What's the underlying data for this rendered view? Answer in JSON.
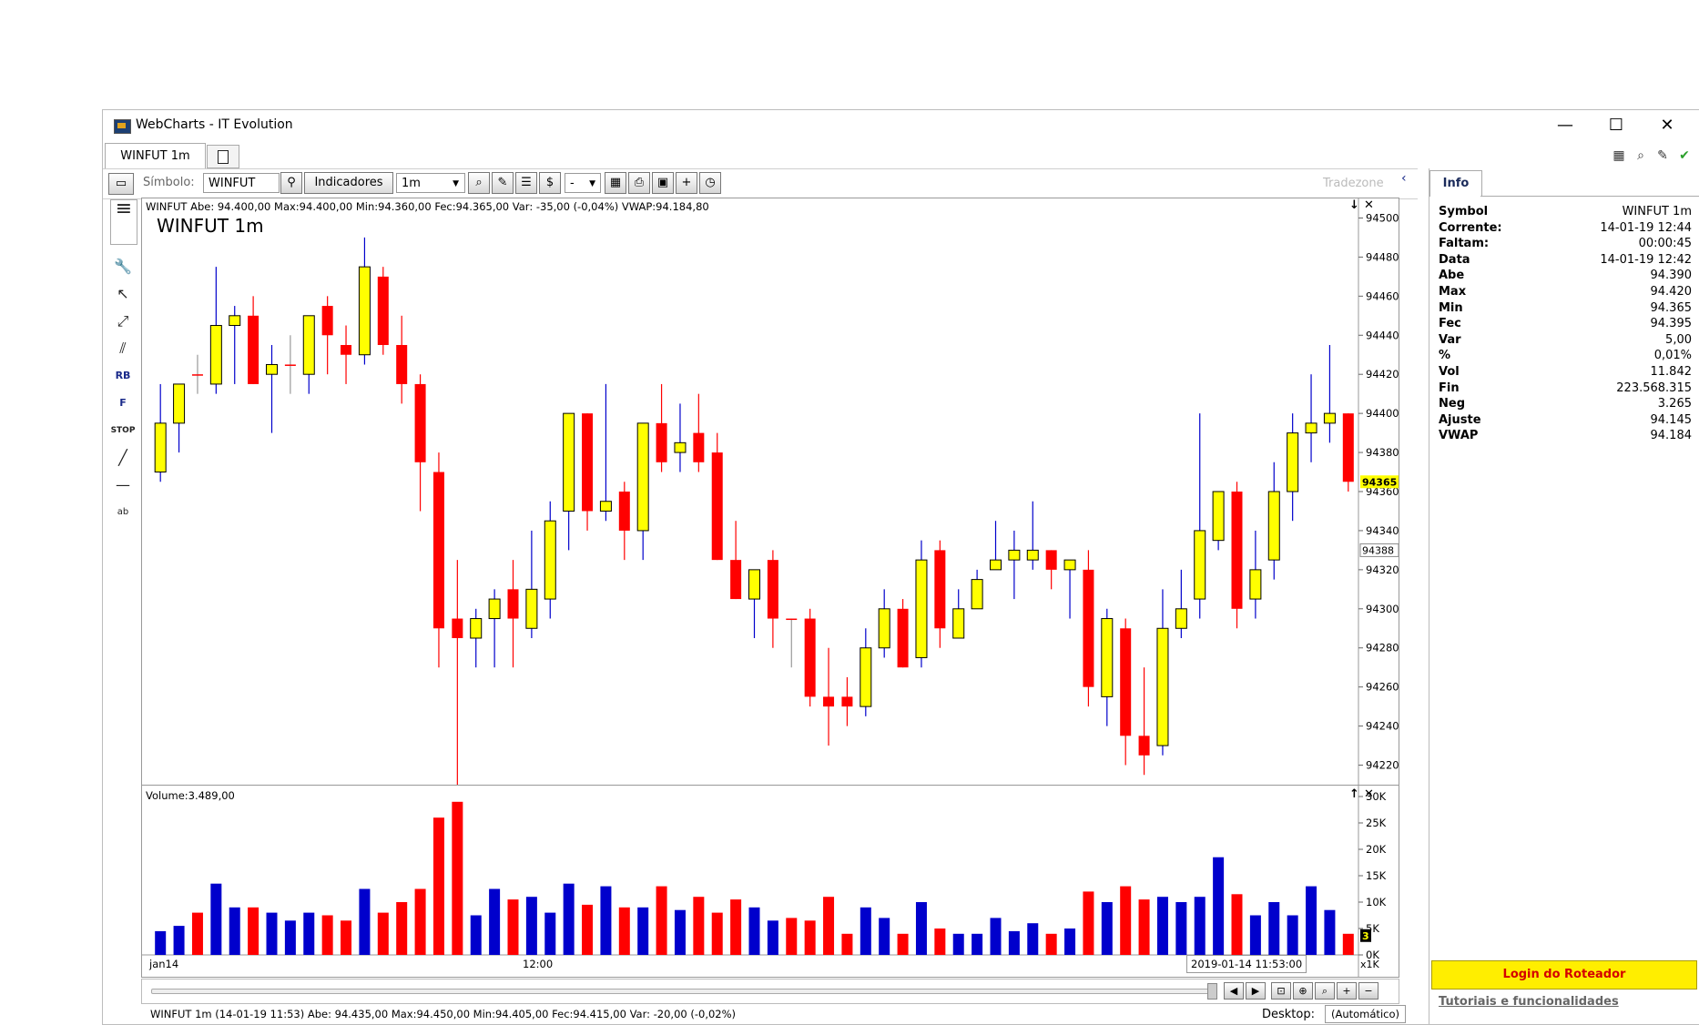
{
  "window": {
    "title": "WebCharts - IT Evolution",
    "minimize": "—",
    "maximize": "☐",
    "close": "✕"
  },
  "tabs": [
    {
      "label": "WINFUT 1m"
    }
  ],
  "toolbar": {
    "symbol_label": "Símbolo:",
    "symbol_value": "WINFUT",
    "indicators_label": "Indicadores",
    "interval_value": "1m",
    "dash_value": "-",
    "tradezone_label": "Tradezone"
  },
  "chart": {
    "header": "WINFUT Abe: 94.400,00  Max:94.400,00  Min:94.360,00  Fec:94.365,00  Var: -35,00 (-0,04%)  VWAP:94.184,80",
    "big_symbol": "WINFUT 1m",
    "current_price_label": "94365",
    "vwap_label": "94388",
    "down_arrow": "↓",
    "close_x": "✕"
  },
  "volume": {
    "header": "Volume:3.489,00",
    "up_arrow": "↑",
    "close_x": "✕",
    "current_badge": "3",
    "x_labels": [
      "jan14",
      "12:00"
    ],
    "unit_label": "x1K",
    "date_tooltip": "2019-01-14 11:53:00"
  },
  "status": {
    "text": "WINFUT 1m  (14-01-19 11:53)  Abe: 94.435,00  Max:94.450,00  Min:94.405,00  Fec:94.415,00  Var: -20,00 (-0,02%)",
    "desktop_label": "Desktop:",
    "desktop_value": "(Automático)"
  },
  "info_panel": {
    "tab_label": "Info",
    "rows": [
      {
        "k": "Symbol",
        "v": "WINFUT 1m"
      },
      {
        "k": "Corrente:",
        "v": "14-01-19 12:44"
      },
      {
        "k": "Faltam:",
        "v": "00:00:45"
      },
      {
        "k": "Data",
        "v": "14-01-19 12:42"
      },
      {
        "k": "Abe",
        "v": "94.390"
      },
      {
        "k": "Max",
        "v": "94.420"
      },
      {
        "k": "Min",
        "v": "94.365"
      },
      {
        "k": "Fec",
        "v": "94.395"
      },
      {
        "k": "Var",
        "v": "5,00"
      },
      {
        "k": "%",
        "v": "0,01%"
      },
      {
        "k": "Vol",
        "v": "11.842"
      },
      {
        "k": "Fin",
        "v": "223.568.315"
      },
      {
        "k": "Neg",
        "v": "3.265"
      },
      {
        "k": "Ajuste",
        "v": "94.145"
      },
      {
        "k": "VWAP",
        "v": "94.184"
      }
    ],
    "login_button": "Login do Roteador",
    "tutorial_link": "Tutoriais e funcionalidades"
  },
  "colors": {
    "up": "#ffff00",
    "down": "#ff0000",
    "wick": "#0000cc",
    "vol_up": "#0000cc",
    "vol_down": "#ff0000",
    "price_badge": "#ffff00"
  },
  "chart_data": [
    {
      "type": "candlestick",
      "title": "WINFUT 1m",
      "ylim": [
        94210,
        94510
      ],
      "yticks": [
        94220,
        94240,
        94260,
        94280,
        94300,
        94320,
        94340,
        94360,
        94380,
        94400,
        94420,
        94440,
        94460,
        94480,
        94500
      ],
      "candles": [
        [
          94370,
          94415,
          94365,
          94395
        ],
        [
          94395,
          94415,
          94380,
          94415
        ],
        [
          94420,
          94430,
          94410,
          94420
        ],
        [
          94415,
          94475,
          94410,
          94445
        ],
        [
          94445,
          94455,
          94415,
          94450
        ],
        [
          94450,
          94460,
          94415,
          94415
        ],
        [
          94420,
          94435,
          94390,
          94425
        ],
        [
          94425,
          94440,
          94410,
          94425
        ],
        [
          94420,
          94450,
          94410,
          94450
        ],
        [
          94455,
          94460,
          94420,
          94440
        ],
        [
          94435,
          94445,
          94415,
          94430
        ],
        [
          94430,
          94490,
          94425,
          94475
        ],
        [
          94470,
          94475,
          94430,
          94435
        ],
        [
          94435,
          94450,
          94405,
          94415
        ],
        [
          94415,
          94420,
          94350,
          94375
        ],
        [
          94370,
          94380,
          94270,
          94290
        ],
        [
          94295,
          94325,
          94210,
          94285
        ],
        [
          94285,
          94300,
          94270,
          94295
        ],
        [
          94295,
          94310,
          94270,
          94305
        ],
        [
          94310,
          94325,
          94270,
          94295
        ],
        [
          94290,
          94340,
          94285,
          94310
        ],
        [
          94305,
          94355,
          94295,
          94345
        ],
        [
          94350,
          94400,
          94330,
          94400
        ],
        [
          94400,
          94400,
          94340,
          94350
        ],
        [
          94350,
          94415,
          94345,
          94355
        ],
        [
          94360,
          94365,
          94325,
          94340
        ],
        [
          94340,
          94395,
          94325,
          94395
        ],
        [
          94395,
          94415,
          94370,
          94375
        ],
        [
          94380,
          94405,
          94370,
          94385
        ],
        [
          94390,
          94410,
          94370,
          94375
        ],
        [
          94380,
          94390,
          94325,
          94325
        ],
        [
          94325,
          94345,
          94305,
          94305
        ],
        [
          94305,
          94320,
          94285,
          94320
        ],
        [
          94325,
          94330,
          94280,
          94295
        ],
        [
          94295,
          94295,
          94270,
          94295
        ],
        [
          94295,
          94300,
          94250,
          94255
        ],
        [
          94255,
          94280,
          94230,
          94250
        ],
        [
          94255,
          94265,
          94240,
          94250
        ],
        [
          94250,
          94290,
          94245,
          94280
        ],
        [
          94280,
          94310,
          94275,
          94300
        ],
        [
          94300,
          94305,
          94270,
          94270
        ],
        [
          94275,
          94335,
          94270,
          94325
        ],
        [
          94330,
          94335,
          94280,
          94290
        ],
        [
          94285,
          94310,
          94285,
          94300
        ],
        [
          94300,
          94320,
          94300,
          94315
        ],
        [
          94320,
          94345,
          94320,
          94325
        ],
        [
          94325,
          94340,
          94305,
          94330
        ],
        [
          94325,
          94355,
          94320,
          94330
        ],
        [
          94330,
          94330,
          94310,
          94320
        ],
        [
          94320,
          94325,
          94295,
          94325
        ],
        [
          94320,
          94330,
          94250,
          94260
        ],
        [
          94255,
          94300,
          94240,
          94295
        ],
        [
          94290,
          94295,
          94220,
          94235
        ],
        [
          94235,
          94270,
          94215,
          94225
        ],
        [
          94230,
          94310,
          94225,
          94290
        ],
        [
          94290,
          94320,
          94285,
          94300
        ],
        [
          94305,
          94400,
          94295,
          94340
        ],
        [
          94335,
          94360,
          94330,
          94360
        ],
        [
          94360,
          94365,
          94290,
          94300
        ],
        [
          94305,
          94340,
          94295,
          94320
        ],
        [
          94325,
          94375,
          94315,
          94360
        ],
        [
          94360,
          94400,
          94345,
          94390
        ],
        [
          94390,
          94420,
          94375,
          94395
        ],
        [
          94395,
          94435,
          94385,
          94400
        ],
        [
          94400,
          94400,
          94360,
          94365
        ]
      ]
    },
    {
      "type": "bar",
      "title": "Volume",
      "ylim": [
        0,
        30000
      ],
      "yticks": [
        0,
        5000,
        10000,
        15000,
        20000,
        25000,
        30000
      ],
      "ytick_labels": [
        "0K",
        "5K",
        "10K",
        "15K",
        "20K",
        "25K",
        "30K"
      ],
      "volumes": [
        4500,
        5500,
        8000,
        13500,
        9000,
        9000,
        8000,
        6500,
        8000,
        7500,
        6500,
        12500,
        8000,
        10000,
        12500,
        26000,
        29000,
        7500,
        12500,
        10500,
        11000,
        8000,
        13500,
        9500,
        13000,
        9000,
        9000,
        13000,
        8500,
        11000,
        8000,
        10500,
        9000,
        6500,
        7000,
        6500,
        11000,
        4000,
        9000,
        7000,
        4000,
        10000,
        5000,
        4000,
        4000,
        7000,
        4500,
        6000,
        4000,
        5000,
        12000,
        10000,
        13000,
        10500,
        11000,
        10000,
        11000,
        18500,
        11500,
        7500,
        10000,
        7500,
        13000,
        8500,
        4000
      ],
      "vol_up": [
        true,
        true,
        false,
        true,
        true,
        false,
        true,
        true,
        true,
        false,
        false,
        true,
        false,
        false,
        false,
        false,
        false,
        true,
        true,
        false,
        true,
        true,
        true,
        false,
        true,
        false,
        true,
        false,
        true,
        false,
        false,
        false,
        true,
        true,
        false,
        false,
        false,
        false,
        true,
        true,
        false,
        true,
        false,
        true,
        true,
        true,
        true,
        true,
        false,
        true,
        false,
        true,
        false,
        false,
        true,
        true,
        true,
        true,
        false,
        true,
        true,
        true,
        true,
        true,
        false
      ]
    }
  ]
}
